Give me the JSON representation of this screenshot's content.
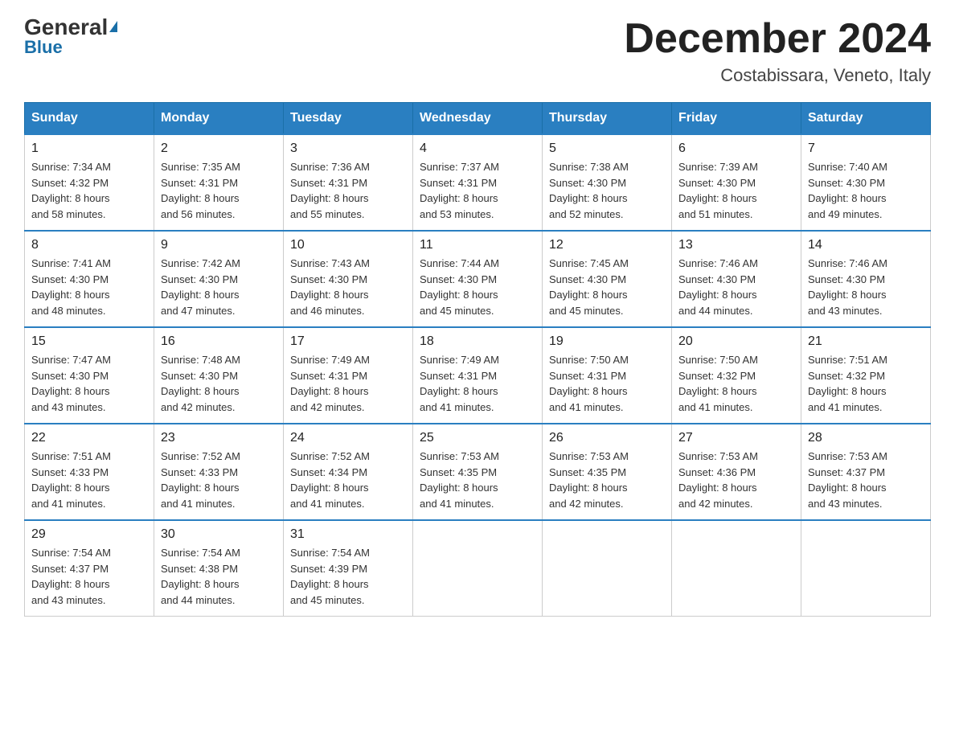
{
  "header": {
    "logo_general": "General",
    "logo_blue": "Blue",
    "month_title": "December 2024",
    "location": "Costabissara, Veneto, Italy"
  },
  "columns": [
    "Sunday",
    "Monday",
    "Tuesday",
    "Wednesday",
    "Thursday",
    "Friday",
    "Saturday"
  ],
  "weeks": [
    [
      {
        "day": "1",
        "sunrise": "7:34 AM",
        "sunset": "4:32 PM",
        "daylight": "8 hours and 58 minutes."
      },
      {
        "day": "2",
        "sunrise": "7:35 AM",
        "sunset": "4:31 PM",
        "daylight": "8 hours and 56 minutes."
      },
      {
        "day": "3",
        "sunrise": "7:36 AM",
        "sunset": "4:31 PM",
        "daylight": "8 hours and 55 minutes."
      },
      {
        "day": "4",
        "sunrise": "7:37 AM",
        "sunset": "4:31 PM",
        "daylight": "8 hours and 53 minutes."
      },
      {
        "day": "5",
        "sunrise": "7:38 AM",
        "sunset": "4:30 PM",
        "daylight": "8 hours and 52 minutes."
      },
      {
        "day": "6",
        "sunrise": "7:39 AM",
        "sunset": "4:30 PM",
        "daylight": "8 hours and 51 minutes."
      },
      {
        "day": "7",
        "sunrise": "7:40 AM",
        "sunset": "4:30 PM",
        "daylight": "8 hours and 49 minutes."
      }
    ],
    [
      {
        "day": "8",
        "sunrise": "7:41 AM",
        "sunset": "4:30 PM",
        "daylight": "8 hours and 48 minutes."
      },
      {
        "day": "9",
        "sunrise": "7:42 AM",
        "sunset": "4:30 PM",
        "daylight": "8 hours and 47 minutes."
      },
      {
        "day": "10",
        "sunrise": "7:43 AM",
        "sunset": "4:30 PM",
        "daylight": "8 hours and 46 minutes."
      },
      {
        "day": "11",
        "sunrise": "7:44 AM",
        "sunset": "4:30 PM",
        "daylight": "8 hours and 45 minutes."
      },
      {
        "day": "12",
        "sunrise": "7:45 AM",
        "sunset": "4:30 PM",
        "daylight": "8 hours and 45 minutes."
      },
      {
        "day": "13",
        "sunrise": "7:46 AM",
        "sunset": "4:30 PM",
        "daylight": "8 hours and 44 minutes."
      },
      {
        "day": "14",
        "sunrise": "7:46 AM",
        "sunset": "4:30 PM",
        "daylight": "8 hours and 43 minutes."
      }
    ],
    [
      {
        "day": "15",
        "sunrise": "7:47 AM",
        "sunset": "4:30 PM",
        "daylight": "8 hours and 43 minutes."
      },
      {
        "day": "16",
        "sunrise": "7:48 AM",
        "sunset": "4:30 PM",
        "daylight": "8 hours and 42 minutes."
      },
      {
        "day": "17",
        "sunrise": "7:49 AM",
        "sunset": "4:31 PM",
        "daylight": "8 hours and 42 minutes."
      },
      {
        "day": "18",
        "sunrise": "7:49 AM",
        "sunset": "4:31 PM",
        "daylight": "8 hours and 41 minutes."
      },
      {
        "day": "19",
        "sunrise": "7:50 AM",
        "sunset": "4:31 PM",
        "daylight": "8 hours and 41 minutes."
      },
      {
        "day": "20",
        "sunrise": "7:50 AM",
        "sunset": "4:32 PM",
        "daylight": "8 hours and 41 minutes."
      },
      {
        "day": "21",
        "sunrise": "7:51 AM",
        "sunset": "4:32 PM",
        "daylight": "8 hours and 41 minutes."
      }
    ],
    [
      {
        "day": "22",
        "sunrise": "7:51 AM",
        "sunset": "4:33 PM",
        "daylight": "8 hours and 41 minutes."
      },
      {
        "day": "23",
        "sunrise": "7:52 AM",
        "sunset": "4:33 PM",
        "daylight": "8 hours and 41 minutes."
      },
      {
        "day": "24",
        "sunrise": "7:52 AM",
        "sunset": "4:34 PM",
        "daylight": "8 hours and 41 minutes."
      },
      {
        "day": "25",
        "sunrise": "7:53 AM",
        "sunset": "4:35 PM",
        "daylight": "8 hours and 41 minutes."
      },
      {
        "day": "26",
        "sunrise": "7:53 AM",
        "sunset": "4:35 PM",
        "daylight": "8 hours and 42 minutes."
      },
      {
        "day": "27",
        "sunrise": "7:53 AM",
        "sunset": "4:36 PM",
        "daylight": "8 hours and 42 minutes."
      },
      {
        "day": "28",
        "sunrise": "7:53 AM",
        "sunset": "4:37 PM",
        "daylight": "8 hours and 43 minutes."
      }
    ],
    [
      {
        "day": "29",
        "sunrise": "7:54 AM",
        "sunset": "4:37 PM",
        "daylight": "8 hours and 43 minutes."
      },
      {
        "day": "30",
        "sunrise": "7:54 AM",
        "sunset": "4:38 PM",
        "daylight": "8 hours and 44 minutes."
      },
      {
        "day": "31",
        "sunrise": "7:54 AM",
        "sunset": "4:39 PM",
        "daylight": "8 hours and 45 minutes."
      },
      null,
      null,
      null,
      null
    ]
  ],
  "labels": {
    "sunrise": "Sunrise:",
    "sunset": "Sunset:",
    "daylight": "Daylight:"
  }
}
